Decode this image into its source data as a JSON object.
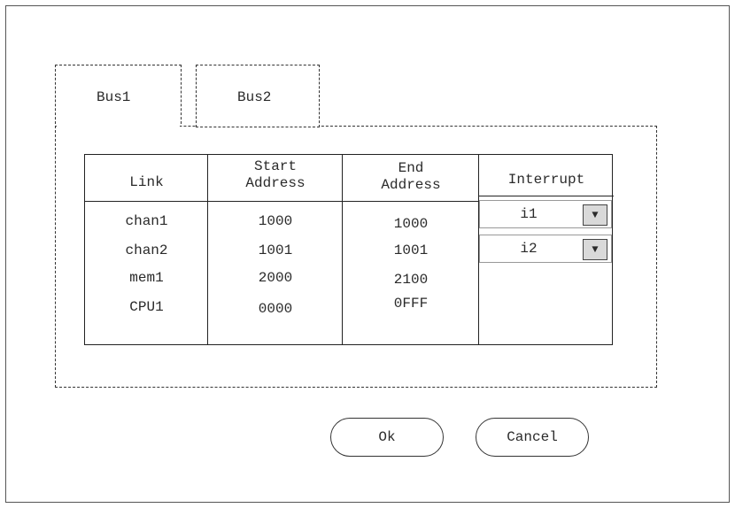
{
  "tabs": [
    {
      "label": "Bus1",
      "active": true
    },
    {
      "label": "Bus2",
      "active": false
    }
  ],
  "table": {
    "headers": {
      "link": "Link",
      "start_line1": "Start",
      "start_line2": "Address",
      "end_line1": "End",
      "end_line2": "Address",
      "interrupt": "Interrupt"
    },
    "rows": [
      {
        "link": "chan1",
        "start": "1000",
        "end": "1000",
        "interrupt": "i1"
      },
      {
        "link": "chan2",
        "start": "1001",
        "end": "1001",
        "interrupt": "i2"
      },
      {
        "link": "mem1",
        "start": "2000",
        "end": "2100",
        "interrupt": ""
      },
      {
        "link": "CPU1",
        "start": "0000",
        "end": "0FFF",
        "interrupt": ""
      }
    ]
  },
  "dropdown_arrow": "▼",
  "buttons": {
    "ok": "Ok",
    "cancel": "Cancel"
  }
}
